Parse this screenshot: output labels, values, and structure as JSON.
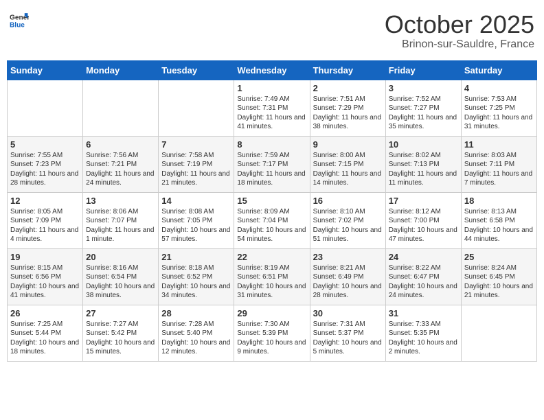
{
  "header": {
    "logo_general": "General",
    "logo_blue": "Blue",
    "month": "October 2025",
    "location": "Brinon-sur-Sauldre, France"
  },
  "days_of_week": [
    "Sunday",
    "Monday",
    "Tuesday",
    "Wednesday",
    "Thursday",
    "Friday",
    "Saturday"
  ],
  "weeks": [
    [
      {
        "day": "",
        "sunrise": "",
        "sunset": "",
        "daylight": ""
      },
      {
        "day": "",
        "sunrise": "",
        "sunset": "",
        "daylight": ""
      },
      {
        "day": "",
        "sunrise": "",
        "sunset": "",
        "daylight": ""
      },
      {
        "day": "1",
        "sunrise": "Sunrise: 7:49 AM",
        "sunset": "Sunset: 7:31 PM",
        "daylight": "Daylight: 11 hours and 41 minutes."
      },
      {
        "day": "2",
        "sunrise": "Sunrise: 7:51 AM",
        "sunset": "Sunset: 7:29 PM",
        "daylight": "Daylight: 11 hours and 38 minutes."
      },
      {
        "day": "3",
        "sunrise": "Sunrise: 7:52 AM",
        "sunset": "Sunset: 7:27 PM",
        "daylight": "Daylight: 11 hours and 35 minutes."
      },
      {
        "day": "4",
        "sunrise": "Sunrise: 7:53 AM",
        "sunset": "Sunset: 7:25 PM",
        "daylight": "Daylight: 11 hours and 31 minutes."
      }
    ],
    [
      {
        "day": "5",
        "sunrise": "Sunrise: 7:55 AM",
        "sunset": "Sunset: 7:23 PM",
        "daylight": "Daylight: 11 hours and 28 minutes."
      },
      {
        "day": "6",
        "sunrise": "Sunrise: 7:56 AM",
        "sunset": "Sunset: 7:21 PM",
        "daylight": "Daylight: 11 hours and 24 minutes."
      },
      {
        "day": "7",
        "sunrise": "Sunrise: 7:58 AM",
        "sunset": "Sunset: 7:19 PM",
        "daylight": "Daylight: 11 hours and 21 minutes."
      },
      {
        "day": "8",
        "sunrise": "Sunrise: 7:59 AM",
        "sunset": "Sunset: 7:17 PM",
        "daylight": "Daylight: 11 hours and 18 minutes."
      },
      {
        "day": "9",
        "sunrise": "Sunrise: 8:00 AM",
        "sunset": "Sunset: 7:15 PM",
        "daylight": "Daylight: 11 hours and 14 minutes."
      },
      {
        "day": "10",
        "sunrise": "Sunrise: 8:02 AM",
        "sunset": "Sunset: 7:13 PM",
        "daylight": "Daylight: 11 hours and 11 minutes."
      },
      {
        "day": "11",
        "sunrise": "Sunrise: 8:03 AM",
        "sunset": "Sunset: 7:11 PM",
        "daylight": "Daylight: 11 hours and 7 minutes."
      }
    ],
    [
      {
        "day": "12",
        "sunrise": "Sunrise: 8:05 AM",
        "sunset": "Sunset: 7:09 PM",
        "daylight": "Daylight: 11 hours and 4 minutes."
      },
      {
        "day": "13",
        "sunrise": "Sunrise: 8:06 AM",
        "sunset": "Sunset: 7:07 PM",
        "daylight": "Daylight: 11 hours and 1 minute."
      },
      {
        "day": "14",
        "sunrise": "Sunrise: 8:08 AM",
        "sunset": "Sunset: 7:05 PM",
        "daylight": "Daylight: 10 hours and 57 minutes."
      },
      {
        "day": "15",
        "sunrise": "Sunrise: 8:09 AM",
        "sunset": "Sunset: 7:04 PM",
        "daylight": "Daylight: 10 hours and 54 minutes."
      },
      {
        "day": "16",
        "sunrise": "Sunrise: 8:10 AM",
        "sunset": "Sunset: 7:02 PM",
        "daylight": "Daylight: 10 hours and 51 minutes."
      },
      {
        "day": "17",
        "sunrise": "Sunrise: 8:12 AM",
        "sunset": "Sunset: 7:00 PM",
        "daylight": "Daylight: 10 hours and 47 minutes."
      },
      {
        "day": "18",
        "sunrise": "Sunrise: 8:13 AM",
        "sunset": "Sunset: 6:58 PM",
        "daylight": "Daylight: 10 hours and 44 minutes."
      }
    ],
    [
      {
        "day": "19",
        "sunrise": "Sunrise: 8:15 AM",
        "sunset": "Sunset: 6:56 PM",
        "daylight": "Daylight: 10 hours and 41 minutes."
      },
      {
        "day": "20",
        "sunrise": "Sunrise: 8:16 AM",
        "sunset": "Sunset: 6:54 PM",
        "daylight": "Daylight: 10 hours and 38 minutes."
      },
      {
        "day": "21",
        "sunrise": "Sunrise: 8:18 AM",
        "sunset": "Sunset: 6:52 PM",
        "daylight": "Daylight: 10 hours and 34 minutes."
      },
      {
        "day": "22",
        "sunrise": "Sunrise: 8:19 AM",
        "sunset": "Sunset: 6:51 PM",
        "daylight": "Daylight: 10 hours and 31 minutes."
      },
      {
        "day": "23",
        "sunrise": "Sunrise: 8:21 AM",
        "sunset": "Sunset: 6:49 PM",
        "daylight": "Daylight: 10 hours and 28 minutes."
      },
      {
        "day": "24",
        "sunrise": "Sunrise: 8:22 AM",
        "sunset": "Sunset: 6:47 PM",
        "daylight": "Daylight: 10 hours and 24 minutes."
      },
      {
        "day": "25",
        "sunrise": "Sunrise: 8:24 AM",
        "sunset": "Sunset: 6:45 PM",
        "daylight": "Daylight: 10 hours and 21 minutes."
      }
    ],
    [
      {
        "day": "26",
        "sunrise": "Sunrise: 7:25 AM",
        "sunset": "Sunset: 5:44 PM",
        "daylight": "Daylight: 10 hours and 18 minutes."
      },
      {
        "day": "27",
        "sunrise": "Sunrise: 7:27 AM",
        "sunset": "Sunset: 5:42 PM",
        "daylight": "Daylight: 10 hours and 15 minutes."
      },
      {
        "day": "28",
        "sunrise": "Sunrise: 7:28 AM",
        "sunset": "Sunset: 5:40 PM",
        "daylight": "Daylight: 10 hours and 12 minutes."
      },
      {
        "day": "29",
        "sunrise": "Sunrise: 7:30 AM",
        "sunset": "Sunset: 5:39 PM",
        "daylight": "Daylight: 10 hours and 9 minutes."
      },
      {
        "day": "30",
        "sunrise": "Sunrise: 7:31 AM",
        "sunset": "Sunset: 5:37 PM",
        "daylight": "Daylight: 10 hours and 5 minutes."
      },
      {
        "day": "31",
        "sunrise": "Sunrise: 7:33 AM",
        "sunset": "Sunset: 5:35 PM",
        "daylight": "Daylight: 10 hours and 2 minutes."
      },
      {
        "day": "",
        "sunrise": "",
        "sunset": "",
        "daylight": ""
      }
    ]
  ]
}
